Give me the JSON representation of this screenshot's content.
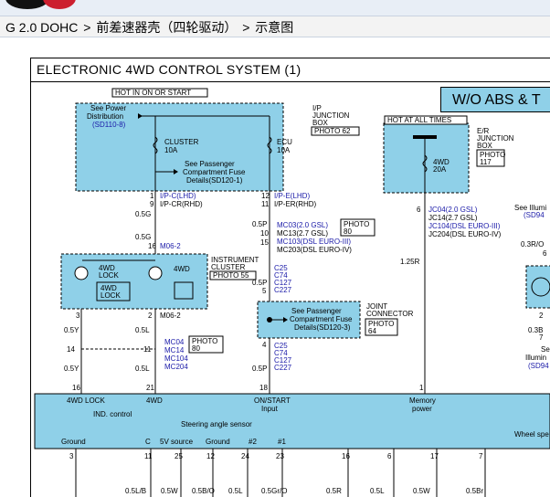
{
  "header": {
    "model": "G 2.0 DOHC",
    "sep1": ">",
    "section": "前差速器壳（四轮驱动）",
    "sep2": ">",
    "page": "示意图"
  },
  "diagram": {
    "title": "ELECTRONIC 4WD CONTROL SYSTEM (1)",
    "banner": "W/O ABS & T",
    "hot_on": "HOT IN ON OR START",
    "hot_all": "HOT AT ALL TIMES",
    "see_power": "See Power",
    "distribution": "Distribution",
    "sd110": "(SD110-8)",
    "ip_junction": [
      "I/P",
      "JUNCTION",
      "BOX"
    ],
    "photo62": "PHOTO 62",
    "cluster_fuse": [
      "CLUSTER",
      "10A"
    ],
    "ecu_fuse": [
      "ECU",
      "10A"
    ],
    "see_pass1": [
      "See Passenger",
      "Compartment Fuse",
      "Details(SD120-1)"
    ],
    "er_junction": [
      "E/R",
      "JUNCTION",
      "BOX"
    ],
    "photo117": [
      "PHOTO",
      "117"
    ],
    "fwd_fuse": [
      "4WD",
      "20A"
    ],
    "see_illum": "See Illumi",
    "sd94a": "(SD94",
    "left_wire": {
      "pin1": "1",
      "pin9": "9",
      "ipc_lhd": "I/P-C(LHD)",
      "ipcr_rhd": "I/P-CR(RHD)",
      "w05g_a": "0.5G",
      "w05g_b": "0.5G",
      "pin16": "16",
      "m062_a": "M06-2",
      "pin3": "3"
    },
    "mid_wire": {
      "pin12": "12",
      "pin11": "11",
      "ipe_lhd": "I/P-E(LHD)",
      "iper_rhd": "I/P-ER(RHD)",
      "w05p": "0.5P",
      "pin10": "10",
      "pin15": "15",
      "mc03": "MC03(2.0 GSL)",
      "mc13": "MC13(2.7 GSL)",
      "mc103": "MC103(DSL EURO-III)",
      "mc203": "MC203(DSL EURO-IV)",
      "photo80a": [
        "PHOTO",
        "80"
      ]
    },
    "right_wire": {
      "pin6": "6",
      "jc04": "JC04(2.0 GSL)",
      "jc14": "JC14(2.7 GSL)",
      "jc104": "JC104(DSL EURO-III)",
      "jc204": "JC204(DSL EURO-IV)",
      "w125r": "1.25R",
      "w03ro": "0.3R/O",
      "pin6b": "6"
    },
    "instrument": {
      "lock_a": "4WD",
      "lock_b": "LOCK",
      "fwd": "4WD",
      "lamp_a": "4WD",
      "lamp_b": "LOCK",
      "label": [
        "INSTRUMENT",
        "CLUSTER"
      ],
      "photo55": "PHOTO 55",
      "pin2": "2",
      "pin7": "7"
    },
    "c_group1": [
      "C25",
      "C74",
      "C127",
      "C227"
    ],
    "pin05p_mid": "0.5P",
    "pin5": "5",
    "joint": {
      "see": [
        "See Passenger",
        "Compartment Fuse",
        "Details(SD120-3)"
      ],
      "label": [
        "JOINT",
        "CONNECTOR"
      ],
      "photo64": [
        "PHOTO",
        "64"
      ],
      "pin4": "4"
    },
    "c_group2": [
      "C25",
      "C74",
      "C127",
      "C227"
    ],
    "lower_left": {
      "p3": "3",
      "p2": "2",
      "w05y_a": "0.5Y",
      "w05l_a": "0.5L",
      "m062_b": "M06-2",
      "p14": "14",
      "p11": "11",
      "w05y_b": "0.5Y",
      "w05l_b": "0.5L",
      "p16": "16",
      "p21": "21",
      "mc04": "MC04",
      "mc14": "MC14",
      "mc104": "MC104",
      "mc204": "MC204",
      "photo80b": [
        "PHOTO",
        "80"
      ],
      "w05p_b": "0.5P",
      "p18": "18",
      "p1": "1"
    },
    "right_side": {
      "p2": "2",
      "w03b": "0.3B",
      "p7": "7",
      "se": "Se",
      "illum": "Illumin",
      "sd94b": "(SD94"
    },
    "ecm": {
      "fwd_lock": "4WD LOCK",
      "fwd": "4WD",
      "ind_control": "IND. control",
      "on_start": "ON/START",
      "input": "Input",
      "memory": "Memory",
      "power": "power",
      "steering": "Steering angle sensor",
      "wheel_speed": "Wheel spe",
      "ground": "Ground",
      "c": "C",
      "v5": "5V source",
      "ground2": "Ground",
      "n2": "#2",
      "n1": "#1"
    },
    "bottom_pins": [
      "3",
      "11",
      "25",
      "12",
      "24",
      "23",
      "16",
      "6",
      "17",
      "7"
    ],
    "bottom_wires": [
      "0.5L/B",
      "0.5W",
      "0.5B/O",
      "0.5L",
      "0.5Gr/O",
      "0.5R",
      "0.5L",
      "0.5W",
      "0.5Br"
    ]
  },
  "colors": {
    "box": "#8fd0e8",
    "blue": "#1a1aa8",
    "logo_red": "#cc1f2f"
  }
}
